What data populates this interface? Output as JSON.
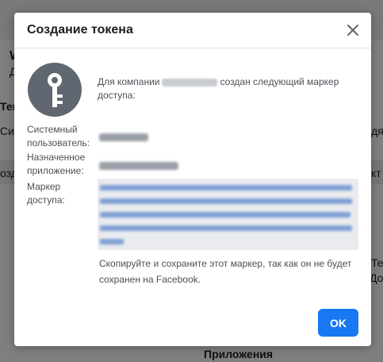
{
  "background": {
    "heading_fragment": "W",
    "subheading_fragment": "Д",
    "section_fragment": "Тек",
    "row_label_fragment_1": "Си",
    "row_label_fragment_2": "озд",
    "right_fragment_1": "дя",
    "right_fragment_2": "кт",
    "right_fragment_3": "Те",
    "right_fragment_4": "Доб",
    "bottom_heading": "Приложения"
  },
  "dialog": {
    "title": "Создание токена",
    "close_icon": "close-icon",
    "key_icon": "key-icon",
    "intro_before": "Для компании",
    "intro_after": "создан следующий маркер доступа:",
    "fields": {
      "system_user_label": "Системный пользователь:",
      "assigned_app_label": "Назначенное приложение:",
      "token_label": "Маркер доступа:"
    },
    "note": "Скопируйте и сохраните этот маркер, так как он не будет сохранен на Facebook.",
    "ok_label": "OK"
  },
  "colors": {
    "primary": "#1877f2",
    "overlay": "rgba(0,0,0,0.5)",
    "icon_circle": "#606770",
    "token_bg": "#e9ebee"
  }
}
